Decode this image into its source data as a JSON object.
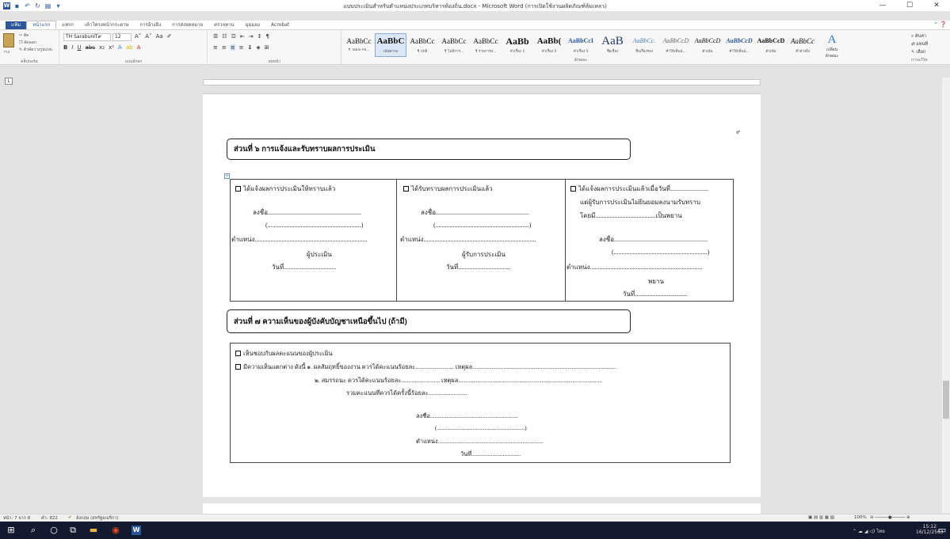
{
  "titlebar": {
    "title": "แบบประเมินสำหรับตำแหน่งประเภทบริหารท้องถิ่น.docx - Microsoft Word (การเปิดใช้งานผลิตภัณฑ์ล้มเหลว)",
    "minimize": "—",
    "maximize": "☐",
    "close": "✕"
  },
  "tabs": {
    "file": "แฟ้ม",
    "items": [
      "หน้าแรก",
      "แทรก",
      "เค้าโครงหน้ากระดาษ",
      "การอ้างอิง",
      "การส่งจดหมาย",
      "ตรวจทาน",
      "มุมมอง",
      "Acrobat"
    ]
  },
  "ribbon": {
    "clipboard": {
      "cut": "ตัด",
      "copy": "คัดลอก",
      "painter": "ตัวคัดวางรูปแบบ",
      "paste": "วาง",
      "label": "คลิปบอร์ด"
    },
    "font": {
      "name": "TH SarabunIT๙",
      "size": "12",
      "label": "แบบอักษร"
    },
    "paragraph": {
      "label": "ย่อหน้า"
    },
    "styles": {
      "label": "ลักษณะ",
      "items": [
        {
          "sample": "AaBbCc",
          "name": "¶ Table Pa..."
        },
        {
          "sample": "AaBbC",
          "name": "เน้นความ"
        },
        {
          "sample": "AaBbCc",
          "name": "¶ ปกติ"
        },
        {
          "sample": "AaBbCc",
          "name": "¶ ไม่มีการ..."
        },
        {
          "sample": "AaBbCc",
          "name": "¶ รายการย่..."
        },
        {
          "sample": "AaBb",
          "name": "หัวเรื่อง 1"
        },
        {
          "sample": "AaBb(",
          "name": "หัวเรื่อง 2"
        },
        {
          "sample": "AaBbCcI",
          "name": "หัวเรื่อง 3"
        },
        {
          "sample": "AaB",
          "name": "ชื่อเรื่อง"
        },
        {
          "sample": "AaBbCc.",
          "name": "ชื่อเรื่องรอง"
        },
        {
          "sample": "AaBbCcD",
          "name": "ทำให้เห็นน์..."
        },
        {
          "sample": "AaBbCcD",
          "name": "ตัวเน้น"
        },
        {
          "sample": "AaBbCcD",
          "name": "ทำให้เห็นน์..."
        },
        {
          "sample": "AaBbCcD",
          "name": "ตัวเข้ม"
        },
        {
          "sample": "AaBbCc",
          "name": "คำอ้างอิง"
        }
      ]
    },
    "change_styles": "เปลี่ยน ลักษณะ",
    "editing": {
      "find": "ค้นหา",
      "replace": "แทนที่",
      "select": "เลือก",
      "label": "การแก้ไข"
    }
  },
  "document": {
    "page_number": "๙",
    "section6": {
      "title": "ส่วนที่ ๖ การแจ้งและรับทราบผลการประเมิน",
      "col1": {
        "check": "ได้แจ้งผลการประเมินให้ทราบแล้ว",
        "sign": "ลงชื่อ...........................................................",
        "name": "(...........................................................)",
        "position": "ตำแหน่ง.......................................................................",
        "role": "ผู้ประเมิน",
        "date": "วันที่................................."
      },
      "col2": {
        "check": "ได้รับทราบผลการประเมินแล้ว",
        "sign": "ลงชื่อ...........................................................",
        "name": "(...........................................................)",
        "position": "ตำแหน่ง.......................................................................",
        "role": "ผู้รับการประเมิน",
        "date": "วันที่................................."
      },
      "col3": {
        "check": "ได้แจ้งผลการประเมินแล้วเมื่อวันที่........................",
        "line2": "แต่ผู้รับการประเมินไม่ยินยอมลงนามรับทราบ",
        "line3": "โดยมี......................................เป็นพยาน",
        "sign": "ลงชื่อ...........................................................",
        "name": "(...........................................................)",
        "position": "ตำแหน่ง.......................................................................",
        "role": "พยาน",
        "date": "วันที่................................."
      }
    },
    "section7": {
      "title": "ส่วนที่ ๗ ความเห็นของผู้บังคับบัญชาเหนือขึ้นไป (ถ้ามี)",
      "agree": "เห็นชอบกับผลคะแนนของผู้ประเมิน",
      "disagree": "มีความเห็นแตกต่าง ดังนี้ ๑. ผลสัมฤทธิ์ของงาน ควรได้คะแนนร้อยละ.......................... เหตุผล.................................................................................................",
      "competency": "๒. สมรรถนะ      ควรได้คะแนนร้อยละ.......................... เหตุผล.................................................................................................",
      "total": "รวมคะแนนที่ควรได้ครั้งนี้ร้อยละ..........................",
      "sign": "ลงชื่อ...........................................................",
      "name": "(...........................................................)",
      "position": "ตำแหน่ง.......................................................................",
      "date": "วันที่................................."
    }
  },
  "statusbar": {
    "page": "หน้า: 7 จาก 8",
    "words": "คำ: 822",
    "language": "อังกฤษ (สหรัฐอเมริกา)",
    "zoom": "100%"
  },
  "taskbar": {
    "time": "15:12",
    "date": "16/12/2563",
    "lang": "ไทย"
  }
}
